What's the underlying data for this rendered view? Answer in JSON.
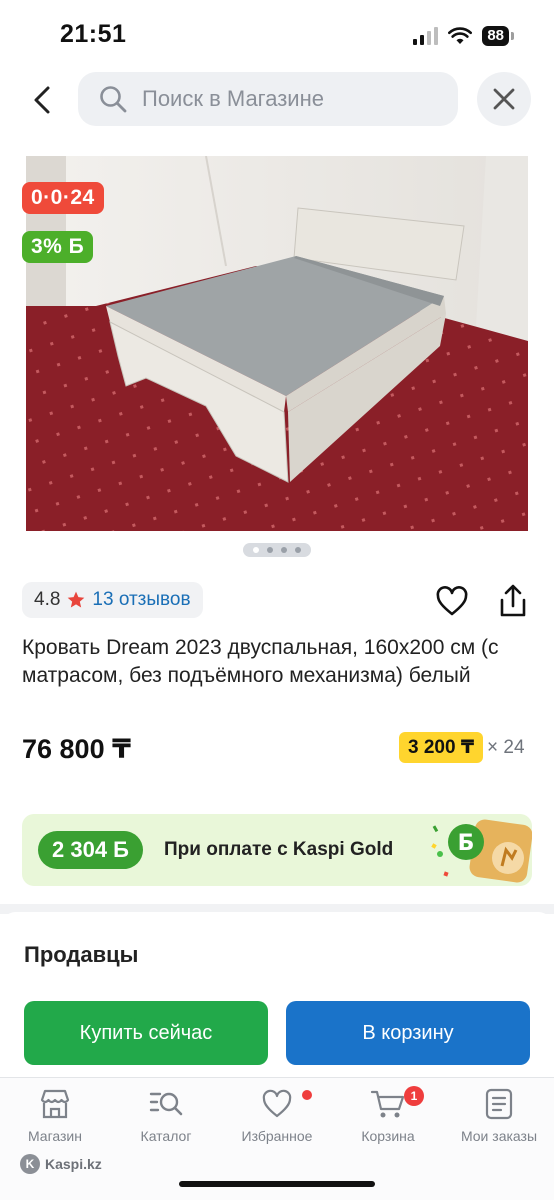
{
  "status_bar": {
    "time": "21:51",
    "battery": "88"
  },
  "header": {
    "search_placeholder": "Поиск в Магазине"
  },
  "product": {
    "badges": {
      "installment": "0·0·24",
      "bonus": "3% Б"
    },
    "gallery": {
      "total": 4,
      "current": 1
    },
    "rating": {
      "value": "4.8",
      "reviews": "13 отзывов"
    },
    "title": "Кровать Dream 2023 двуспальная, 160х200 см (с матрасом, без подъёмного механизма) белый",
    "price": "76 800 ₸",
    "installment": {
      "amount": "3 200 ₸",
      "months": "× 24"
    }
  },
  "kaspi_gold": {
    "bonus": "2 304 Б",
    "text": "При оплате с Kaspi Gold"
  },
  "sellers": {
    "title": "Продавцы",
    "buy_now": "Купить сейчас",
    "add_to_cart": "В корзину"
  },
  "tabbar": {
    "items": [
      {
        "label": "Магазин",
        "icon": "store-icon"
      },
      {
        "label": "Каталог",
        "icon": "catalog-search-icon"
      },
      {
        "label": "Избранное",
        "icon": "heart-icon",
        "dot": true
      },
      {
        "label": "Корзина",
        "icon": "cart-icon",
        "count": "1"
      },
      {
        "label": "Мои заказы",
        "icon": "orders-icon"
      }
    ]
  },
  "watermark": "Kaspi.kz",
  "colors": {
    "installment_badge": "#ef4a3a",
    "bonus_badge": "#4caf2a",
    "installment_highlight": "#ffd52e",
    "buy_button": "#22a94a",
    "cart_button": "#1a73c9",
    "link": "#1a6fb6",
    "gold_banner_bg": "#e9f7d9",
    "carpet": "#8a1f28"
  }
}
